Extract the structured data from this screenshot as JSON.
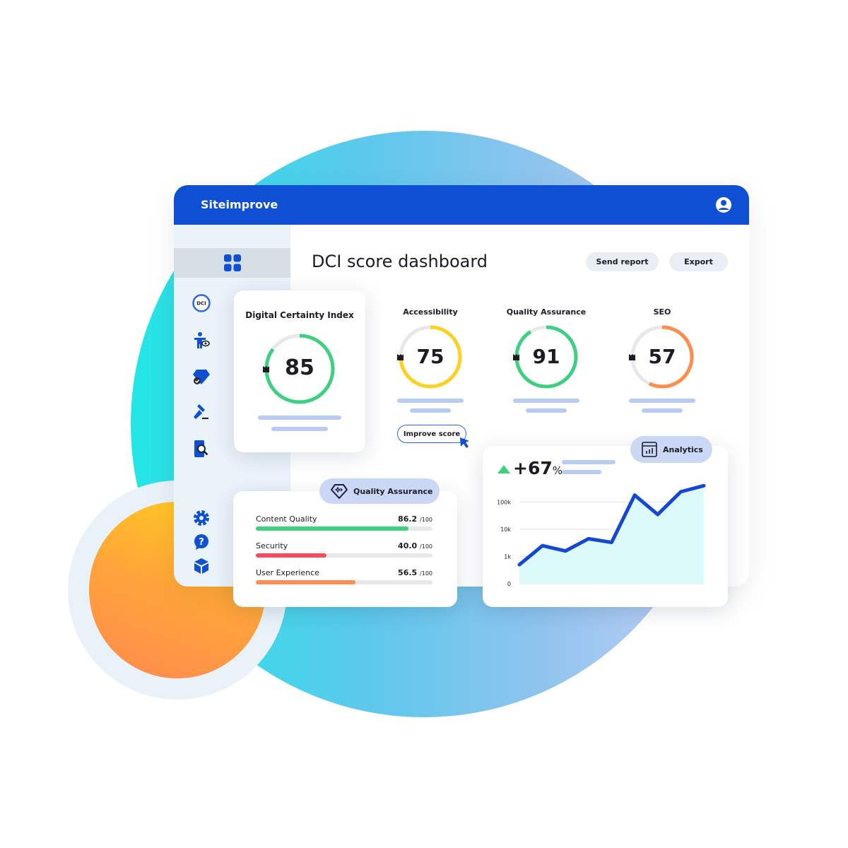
{
  "app": {
    "brand": "Siteimprove",
    "user_icon": "user-circle-icon"
  },
  "sidebar": {
    "items": [
      {
        "icon": "grid-dashboard-icon",
        "active": true
      },
      {
        "icon": "dci-icon",
        "text": "DCI"
      },
      {
        "icon": "accessibility-eye-icon"
      },
      {
        "icon": "diamond-check-icon"
      },
      {
        "icon": "gavel-icon"
      },
      {
        "icon": "mobile-search-icon"
      },
      {
        "icon": "gear-icon"
      },
      {
        "icon": "help-icon"
      },
      {
        "icon": "cube-icon"
      }
    ]
  },
  "header": {
    "title": "DCI score dashboard",
    "send_report": "Send report",
    "export": "Export"
  },
  "dci": {
    "title": "Digital Certainty Index",
    "score": 85,
    "color": "#3ecf80"
  },
  "scores": [
    {
      "label": "Accessibility",
      "score": 75,
      "color": "#fcd21e"
    },
    {
      "label": "Quality Assurance",
      "score": 91,
      "color": "#3ecf80"
    },
    {
      "label": "SEO",
      "score": 57,
      "color": "#ff8c4a"
    }
  ],
  "improve_button": "Improve score",
  "qa": {
    "pill": "Quality Assurance",
    "rows": [
      {
        "label": "Content Quality",
        "value": "86.2",
        "max": "/100",
        "pct": 86.2,
        "color": "#3dd07e"
      },
      {
        "label": "Security",
        "value": "40.0",
        "max": "/100",
        "pct": 40,
        "color": "#f94a5f"
      },
      {
        "label": "User Experience",
        "value": "56.5",
        "max": "/100",
        "pct": 56.5,
        "color": "#ff8c50"
      }
    ]
  },
  "analytics": {
    "pill": "Analytics",
    "change": "+67",
    "change_unit": "%",
    "trend": "up",
    "trend_color": "#3ecf80"
  },
  "chart_data": {
    "type": "area",
    "scale": "log",
    "ytick_labels": [
      "0",
      "1k",
      "10k",
      "100k"
    ],
    "yticks": [
      0,
      1000,
      10000,
      100000
    ],
    "values": [
      500,
      2500,
      1600,
      4500,
      3300,
      180000,
      35000,
      240000,
      400000
    ],
    "line_color": "#1448d4",
    "fill_color": "#dcfafa",
    "grid": true
  }
}
